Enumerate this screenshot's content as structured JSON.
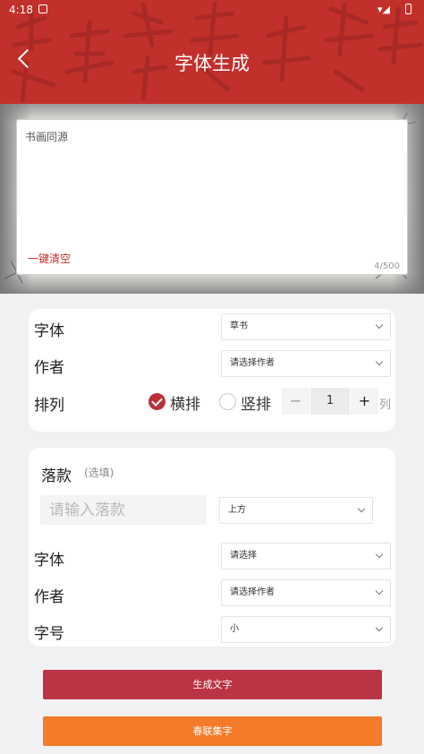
{
  "status_bar": {
    "time": "4:18"
  },
  "header": {
    "title": "字体生成"
  },
  "text_area": {
    "content": "书画同源",
    "clear_label": "一键清空",
    "counter": "4/500"
  },
  "settings": {
    "font_label": "字体",
    "font_value": "草书",
    "author_label": "作者",
    "author_value": "请选择作者",
    "layout_label": "排列",
    "horizontal_label": "横排",
    "vertical_label": "竖排",
    "horizontal_selected": true,
    "columns": "1",
    "columns_unit": "列"
  },
  "signature": {
    "title": "落款",
    "optional_label": "(选填)",
    "input_placeholder": "请输入落款",
    "position_value": "上方",
    "font_label": "字体",
    "font_value": "请选择",
    "author_label": "作者",
    "author_value": "请选择作者",
    "size_label": "字号",
    "size_value": "小"
  },
  "buttons": {
    "generate": "生成文字",
    "couplet": "春联集字"
  },
  "colors": {
    "header": "#c2302b",
    "primary_button": "#bb3445",
    "secondary_button": "#f37b2a"
  }
}
